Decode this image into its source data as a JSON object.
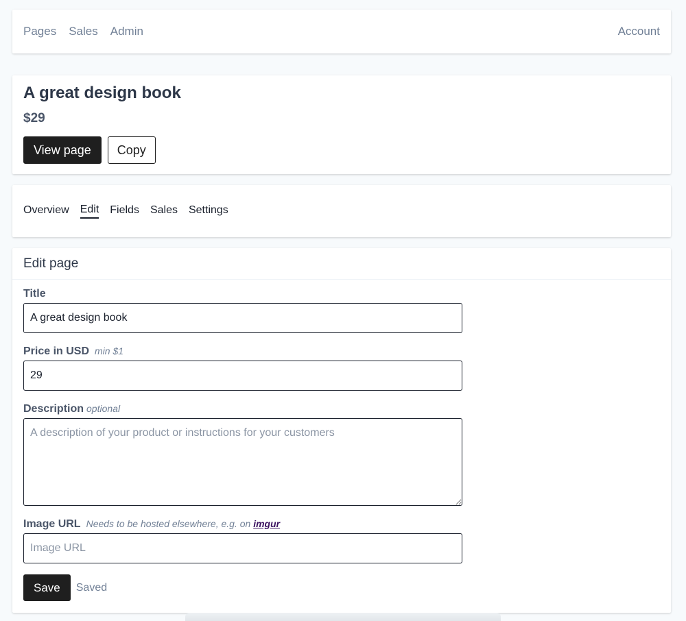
{
  "nav": {
    "items": [
      "Pages",
      "Sales",
      "Admin"
    ],
    "account": "Account"
  },
  "product": {
    "title": "A great design book",
    "price": "$29",
    "view_button": "View page",
    "copy_button": "Copy"
  },
  "tabs": [
    {
      "label": "Overview",
      "active": false
    },
    {
      "label": "Edit",
      "active": true
    },
    {
      "label": "Fields",
      "active": false
    },
    {
      "label": "Sales",
      "active": false
    },
    {
      "label": "Settings",
      "active": false
    }
  ],
  "edit": {
    "heading": "Edit page",
    "title_label": "Title",
    "title_value": "A great design book",
    "price_label": "Price in USD",
    "price_hint": "min $1",
    "price_value": "29",
    "description_label": "Description",
    "description_hint": "optional",
    "description_placeholder": "A description of your product or instructions for your customers",
    "image_label": "Image URL",
    "image_hint": "Needs to be hosted elsewhere, e.g. on",
    "image_hint_link": "imgur",
    "image_placeholder": "Image URL",
    "save_button": "Save",
    "save_status": "Saved"
  }
}
